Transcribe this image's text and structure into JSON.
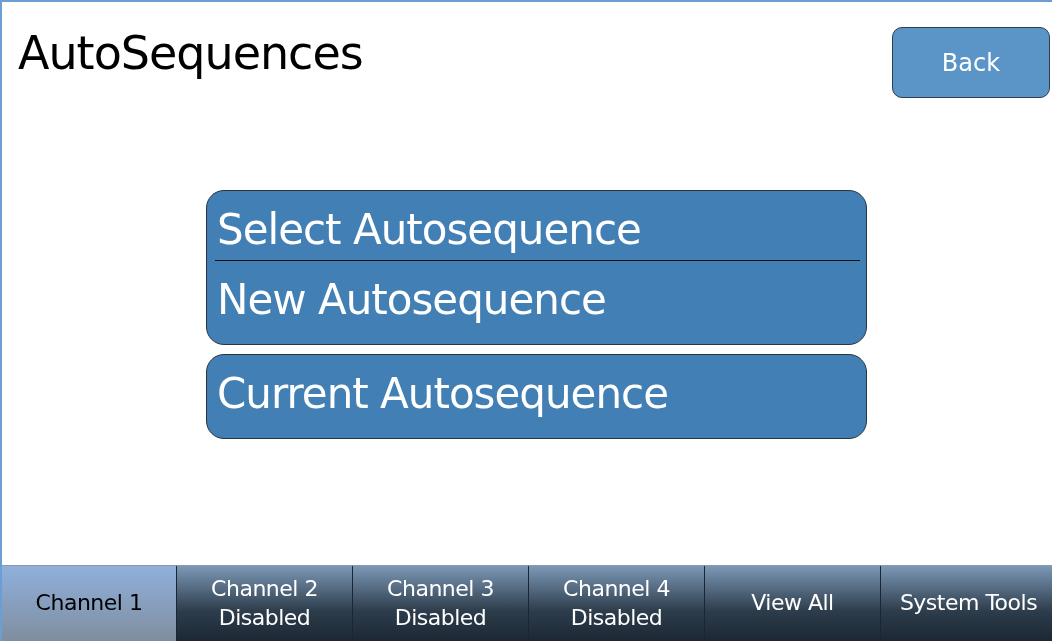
{
  "title": "AutoSequences",
  "back_button": {
    "label": "Back"
  },
  "menu_groups": [
    {
      "items": [
        {
          "label": "Select Autosequence"
        },
        {
          "label": "New Autosequence"
        }
      ]
    },
    {
      "items": [
        {
          "label": "Current Autosequence"
        }
      ]
    }
  ],
  "tabs": [
    {
      "label": "Channel 1",
      "selected": true
    },
    {
      "label": "Channel 2\nDisabled",
      "selected": false
    },
    {
      "label": "Channel 3\nDisabled",
      "selected": false
    },
    {
      "label": "Channel 4\nDisabled",
      "selected": false
    },
    {
      "label": "View All",
      "selected": false
    },
    {
      "label": "System Tools",
      "selected": false
    }
  ]
}
